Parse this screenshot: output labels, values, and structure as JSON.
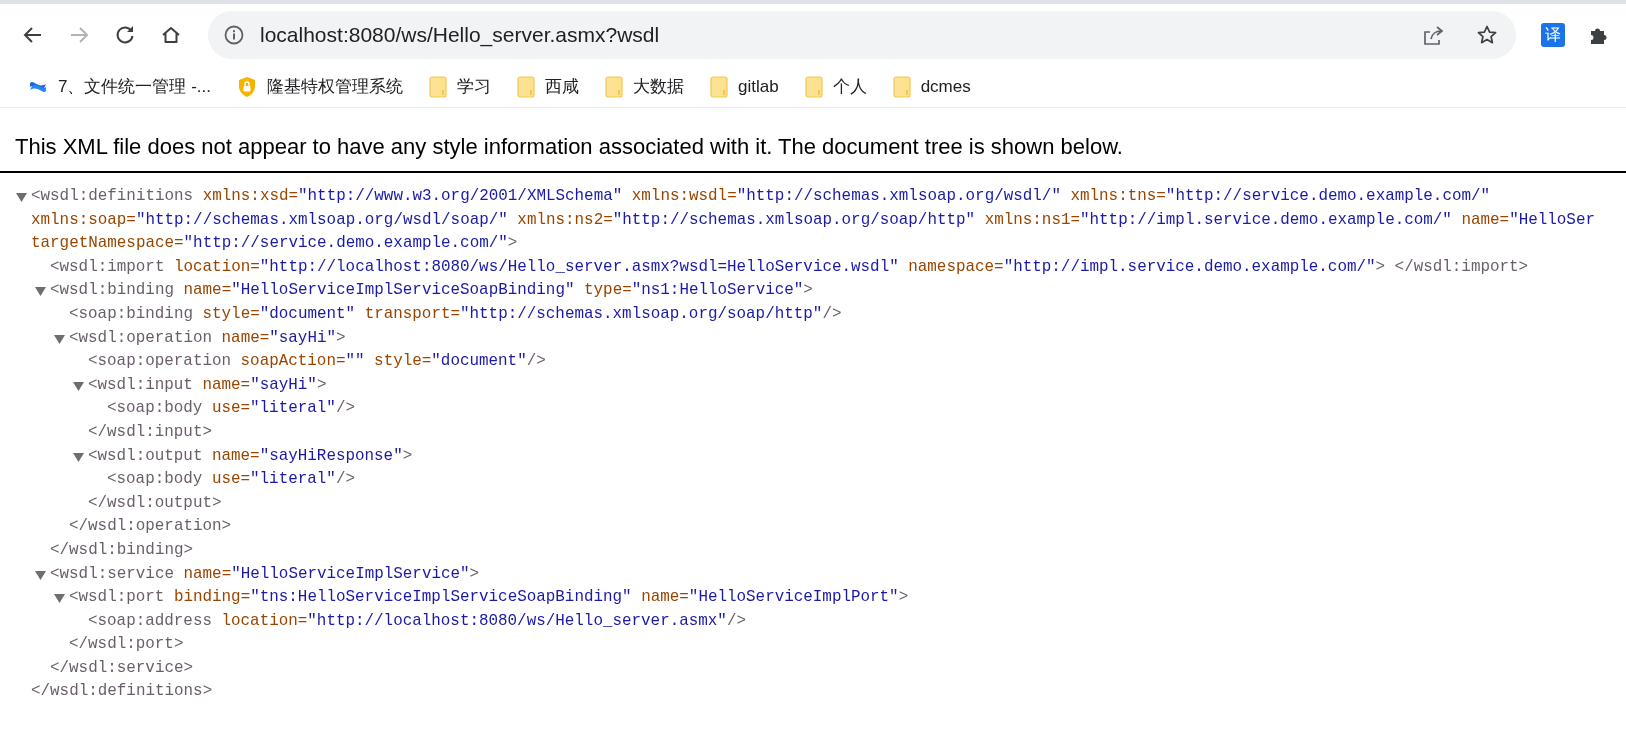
{
  "toolbar": {
    "address": "localhost:8080/ws/Hello_server.asmx?wsdl",
    "forward_disabled": true,
    "translate_label": "译"
  },
  "bookmarks": [
    {
      "kind": "app",
      "label": "7、文件统一管理 -..."
    },
    {
      "kind": "shield",
      "label": "隆基特权管理系统"
    },
    {
      "kind": "folder",
      "label": "学习"
    },
    {
      "kind": "folder",
      "label": "西咸"
    },
    {
      "kind": "folder",
      "label": "大数据"
    },
    {
      "kind": "folder",
      "label": "gitlab"
    },
    {
      "kind": "folder",
      "label": "个人"
    },
    {
      "kind": "folder",
      "label": "dcmes"
    }
  ],
  "notice": "This XML file does not appear to have any style information associated with it. The document tree is shown below.",
  "xml_tree": {
    "expanded": true,
    "lines": [
      [
        {
          "kind": "tag",
          "text": "<wsdl:definitions"
        },
        {
          "kind": "attr",
          "text": " xmlns:xsd="
        },
        {
          "kind": "value",
          "text": "\"http://www.w3.org/2001/XMLSchema\""
        },
        {
          "kind": "attr",
          "text": " xmlns:wsdl="
        },
        {
          "kind": "value",
          "text": "\"http://schemas.xmlsoap.org/wsdl/\""
        },
        {
          "kind": "attr",
          "text": " xmlns:tns="
        },
        {
          "kind": "value",
          "text": "\"http://service.demo.example.com/\""
        }
      ],
      [
        {
          "kind": "attr",
          "text": "xmlns:soap="
        },
        {
          "kind": "value",
          "text": "\"http://schemas.xmlsoap.org/wsdl/soap/\""
        },
        {
          "kind": "attr",
          "text": " xmlns:ns2="
        },
        {
          "kind": "value",
          "text": "\"http://schemas.xmlsoap.org/soap/http\""
        },
        {
          "kind": "attr",
          "text": " xmlns:ns1="
        },
        {
          "kind": "value",
          "text": "\"http://impl.service.demo.example.com/\""
        },
        {
          "kind": "attr",
          "text": " name="
        },
        {
          "kind": "value",
          "text": "\"HelloSer"
        }
      ],
      [
        {
          "kind": "attr",
          "text": "targetNamespace="
        },
        {
          "kind": "value",
          "text": "\"http://service.demo.example.com/\""
        },
        {
          "kind": "tag",
          "text": ">"
        }
      ]
    ],
    "children": [
      {
        "lines": [
          [
            {
              "kind": "tag",
              "text": "<wsdl:import"
            },
            {
              "kind": "attr",
              "text": " location="
            },
            {
              "kind": "value",
              "text": "\"http://localhost:8080/ws/Hello_server.asmx?wsdl=HelloService.wsdl\""
            },
            {
              "kind": "attr",
              "text": " namespace="
            },
            {
              "kind": "value",
              "text": "\"http://impl.service.demo.example.com/\""
            },
            {
              "kind": "tag",
              "text": "> </wsdl:import>"
            }
          ]
        ]
      },
      {
        "expanded": true,
        "lines": [
          [
            {
              "kind": "tag",
              "text": "<wsdl:binding"
            },
            {
              "kind": "attr",
              "text": " name="
            },
            {
              "kind": "value",
              "text": "\"HelloServiceImplServiceSoapBinding\""
            },
            {
              "kind": "attr",
              "text": " type="
            },
            {
              "kind": "value",
              "text": "\"ns1:HelloService\""
            },
            {
              "kind": "tag",
              "text": ">"
            }
          ]
        ],
        "children": [
          {
            "lines": [
              [
                {
                  "kind": "tag",
                  "text": "<soap:binding"
                },
                {
                  "kind": "attr",
                  "text": " style="
                },
                {
                  "kind": "value",
                  "text": "\"document\""
                },
                {
                  "kind": "attr",
                  "text": " transport="
                },
                {
                  "kind": "value",
                  "text": "\"http://schemas.xmlsoap.org/soap/http\""
                },
                {
                  "kind": "tag",
                  "text": "/>"
                }
              ]
            ]
          },
          {
            "expanded": true,
            "lines": [
              [
                {
                  "kind": "tag",
                  "text": "<wsdl:operation"
                },
                {
                  "kind": "attr",
                  "text": " name="
                },
                {
                  "kind": "value",
                  "text": "\"sayHi\""
                },
                {
                  "kind": "tag",
                  "text": ">"
                }
              ]
            ],
            "children": [
              {
                "lines": [
                  [
                    {
                      "kind": "tag",
                      "text": "<soap:operation"
                    },
                    {
                      "kind": "attr",
                      "text": " soapAction="
                    },
                    {
                      "kind": "value",
                      "text": "\"\""
                    },
                    {
                      "kind": "attr",
                      "text": " style="
                    },
                    {
                      "kind": "value",
                      "text": "\"document\""
                    },
                    {
                      "kind": "tag",
                      "text": "/>"
                    }
                  ]
                ]
              },
              {
                "expanded": true,
                "lines": [
                  [
                    {
                      "kind": "tag",
                      "text": "<wsdl:input"
                    },
                    {
                      "kind": "attr",
                      "text": " name="
                    },
                    {
                      "kind": "value",
                      "text": "\"sayHi\""
                    },
                    {
                      "kind": "tag",
                      "text": ">"
                    }
                  ]
                ],
                "children": [
                  {
                    "lines": [
                      [
                        {
                          "kind": "tag",
                          "text": "<soap:body"
                        },
                        {
                          "kind": "attr",
                          "text": " use="
                        },
                        {
                          "kind": "value",
                          "text": "\"literal\""
                        },
                        {
                          "kind": "tag",
                          "text": "/>"
                        }
                      ]
                    ]
                  }
                ],
                "close": "</wsdl:input>"
              },
              {
                "expanded": true,
                "lines": [
                  [
                    {
                      "kind": "tag",
                      "text": "<wsdl:output"
                    },
                    {
                      "kind": "attr",
                      "text": " name="
                    },
                    {
                      "kind": "value",
                      "text": "\"sayHiResponse\""
                    },
                    {
                      "kind": "tag",
                      "text": ">"
                    }
                  ]
                ],
                "children": [
                  {
                    "lines": [
                      [
                        {
                          "kind": "tag",
                          "text": "<soap:body"
                        },
                        {
                          "kind": "attr",
                          "text": " use="
                        },
                        {
                          "kind": "value",
                          "text": "\"literal\""
                        },
                        {
                          "kind": "tag",
                          "text": "/>"
                        }
                      ]
                    ]
                  }
                ],
                "close": "</wsdl:output>"
              }
            ],
            "close": "</wsdl:operation>"
          }
        ],
        "close": "</wsdl:binding>"
      },
      {
        "expanded": true,
        "lines": [
          [
            {
              "kind": "tag",
              "text": "<wsdl:service"
            },
            {
              "kind": "attr",
              "text": " name="
            },
            {
              "kind": "value",
              "text": "\"HelloServiceImplService\""
            },
            {
              "kind": "tag",
              "text": ">"
            }
          ]
        ],
        "children": [
          {
            "expanded": true,
            "lines": [
              [
                {
                  "kind": "tag",
                  "text": "<wsdl:port"
                },
                {
                  "kind": "attr",
                  "text": " binding="
                },
                {
                  "kind": "value",
                  "text": "\"tns:HelloServiceImplServiceSoapBinding\""
                },
                {
                  "kind": "attr",
                  "text": " name="
                },
                {
                  "kind": "value",
                  "text": "\"HelloServiceImplPort\""
                },
                {
                  "kind": "tag",
                  "text": ">"
                }
              ]
            ],
            "children": [
              {
                "lines": [
                  [
                    {
                      "kind": "tag",
                      "text": "<soap:address"
                    },
                    {
                      "kind": "attr",
                      "text": " location="
                    },
                    {
                      "kind": "value",
                      "text": "\"http://localhost:8080/ws/Hello_server.asmx\""
                    },
                    {
                      "kind": "tag",
                      "text": "/>"
                    }
                  ]
                ]
              }
            ],
            "close": "</wsdl:port>"
          }
        ],
        "close": "</wsdl:service>"
      }
    ],
    "close": "</wsdl:definitions>"
  }
}
